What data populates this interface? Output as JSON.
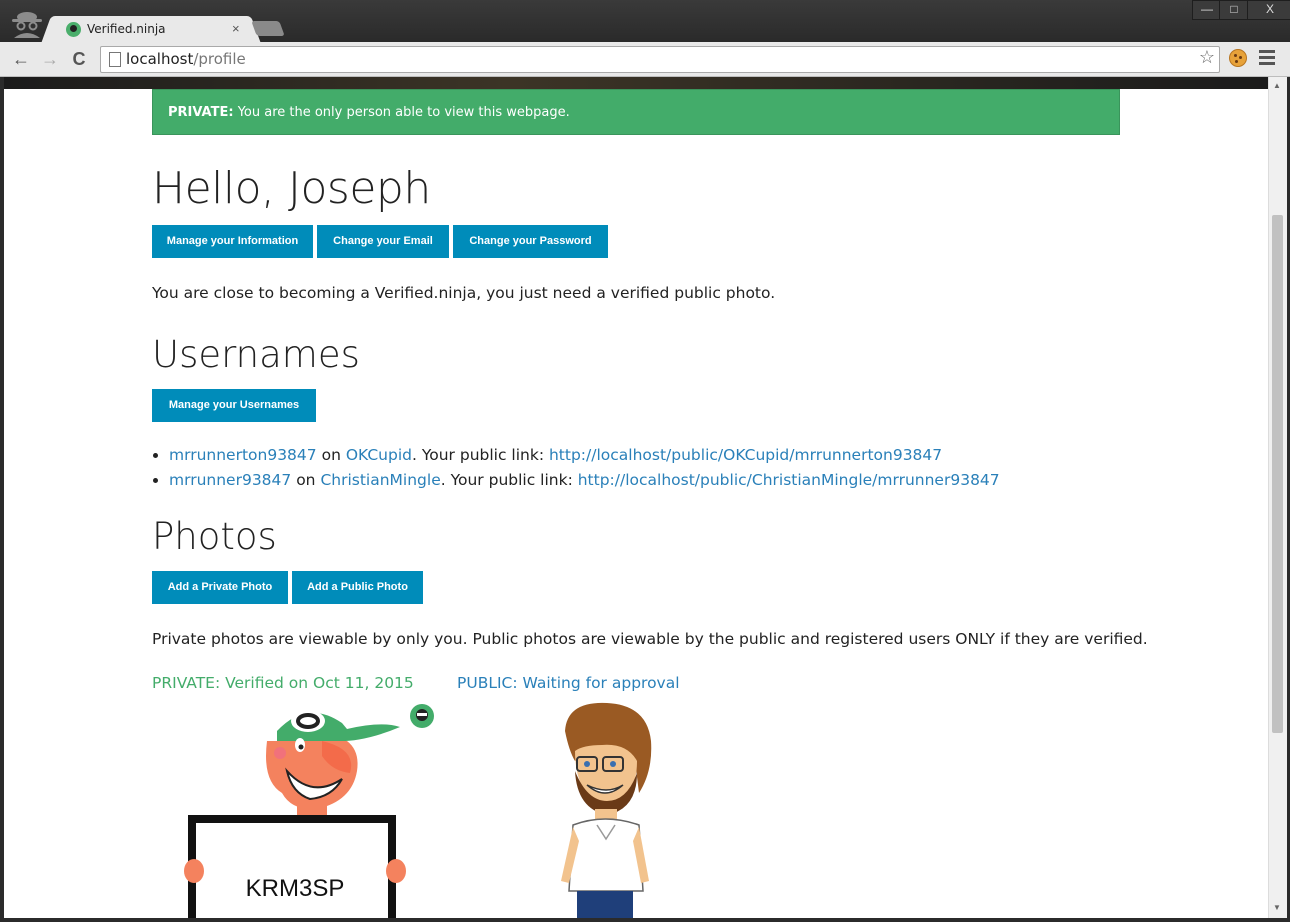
{
  "browser": {
    "tab_title": "Verified.ninja",
    "tab_close": "×",
    "url_host": "localhost",
    "url_path": "/profile",
    "win_minimize": "—",
    "win_maximize": "□",
    "win_close": "X",
    "back": "←",
    "forward": "→",
    "reload": "C",
    "star": "☆",
    "icons": [
      "incognito-icon",
      "favicon-icon",
      "back-icon",
      "forward-icon",
      "reload-icon",
      "page-icon",
      "star-icon",
      "cookie-icon",
      "menu-icon"
    ]
  },
  "alert": {
    "label": "PRIVATE:",
    "text": " You are the only person able to view this webpage."
  },
  "greeting": "Hello, Joseph",
  "account_buttons": [
    "Manage your Information",
    "Change your Email",
    "Change your Password"
  ],
  "verify_message": "You are close to becoming a Verified.ninja, you just need a verified public photo.",
  "usernames": {
    "heading": "Usernames",
    "manage_button": "Manage your Usernames",
    "items": [
      {
        "username": "mrrunnerton93847",
        "on": " on ",
        "site": "OKCupid",
        "link_text": ". Your public link: ",
        "link": "http://localhost/public/OKCupid/mrrunnerton93847"
      },
      {
        "username": "mrrunner93847",
        "on": " on ",
        "site": "ChristianMingle",
        "link_text": ". Your public link: ",
        "link": "http://localhost/public/ChristianMingle/mrrunner93847"
      }
    ]
  },
  "photos": {
    "heading": "Photos",
    "add_private": "Add a Private Photo",
    "add_public": "Add a Public Photo",
    "description": "Private photos are viewable by only you. Public photos are viewable by the public and registered users ONLY if they are verified.",
    "private_status": "PRIVATE: Verified on Oct 11, 2015",
    "public_status": "PUBLIC: Waiting for approval",
    "sign_code": "KRM3SP"
  },
  "colors": {
    "alert_green": "#43ac6a",
    "button_blue": "#008cba",
    "link_blue": "#2a80b9"
  }
}
